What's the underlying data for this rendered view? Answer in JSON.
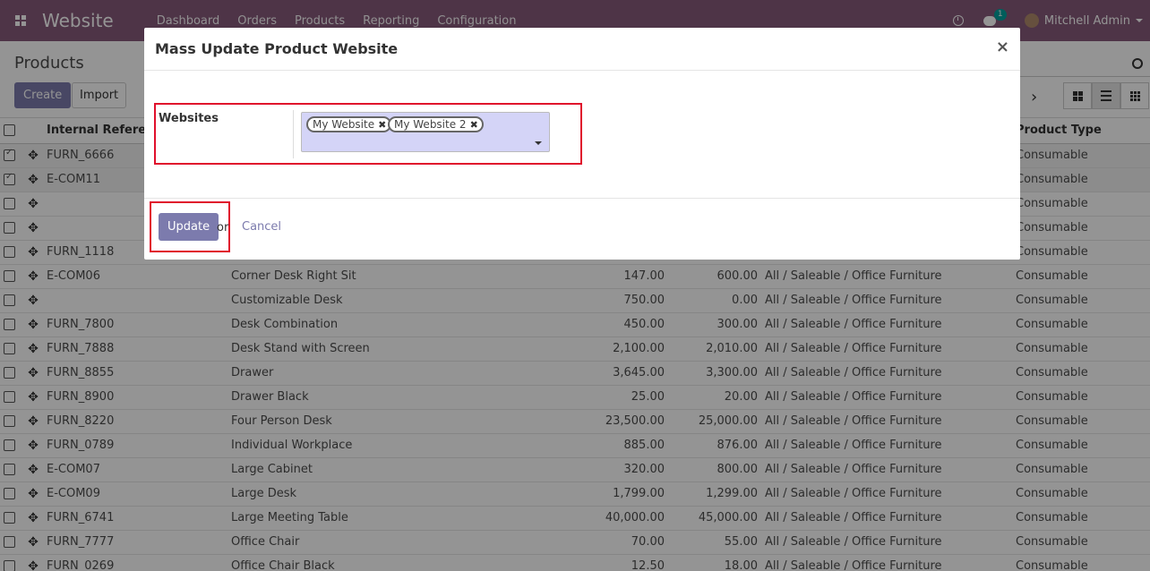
{
  "navbar": {
    "brand": "Website",
    "menu": [
      "Dashboard",
      "Orders",
      "Products",
      "Reporting",
      "Configuration"
    ],
    "chat_badge": "1",
    "user": "Mitchell Admin"
  },
  "control": {
    "breadcrumb": "Products",
    "create_label": "Create",
    "import_label": "Import"
  },
  "list": {
    "headers": {
      "internal_reference": "Internal Reference",
      "product_type": "Product Type"
    },
    "rows": [
      {
        "ref": "FURN_6666",
        "name": "",
        "price": "",
        "cost": "",
        "category": "",
        "type": "Consumable",
        "checked": true
      },
      {
        "ref": "E-COM11",
        "name": "",
        "price": "",
        "cost": "",
        "category": "",
        "type": "Consumable",
        "checked": true
      },
      {
        "ref": "",
        "name": "",
        "price": "",
        "cost": "",
        "category": "",
        "type": "Consumable",
        "checked": false
      },
      {
        "ref": "",
        "name": "",
        "price": "",
        "cost": "",
        "category": "",
        "type": "Consumable",
        "checked": false
      },
      {
        "ref": "FURN_1118",
        "name": "",
        "price": "",
        "cost": "",
        "category": "",
        "type": "Consumable",
        "checked": false
      },
      {
        "ref": "E-COM06",
        "name": "Corner Desk Right Sit",
        "price": "147.00",
        "cost": "600.00",
        "category": "All / Saleable / Office Furniture",
        "type": "Consumable",
        "checked": false
      },
      {
        "ref": "",
        "name": "Customizable Desk",
        "price": "750.00",
        "cost": "0.00",
        "category": "All / Saleable / Office Furniture",
        "type": "Consumable",
        "checked": false
      },
      {
        "ref": "FURN_7800",
        "name": "Desk Combination",
        "price": "450.00",
        "cost": "300.00",
        "category": "All / Saleable / Office Furniture",
        "type": "Consumable",
        "checked": false
      },
      {
        "ref": "FURN_7888",
        "name": "Desk Stand with Screen",
        "price": "2,100.00",
        "cost": "2,010.00",
        "category": "All / Saleable / Office Furniture",
        "type": "Consumable",
        "checked": false
      },
      {
        "ref": "FURN_8855",
        "name": "Drawer",
        "price": "3,645.00",
        "cost": "3,300.00",
        "category": "All / Saleable / Office Furniture",
        "type": "Consumable",
        "checked": false
      },
      {
        "ref": "FURN_8900",
        "name": "Drawer Black",
        "price": "25.00",
        "cost": "20.00",
        "category": "All / Saleable / Office Furniture",
        "type": "Consumable",
        "checked": false
      },
      {
        "ref": "FURN_8220",
        "name": "Four Person Desk",
        "price": "23,500.00",
        "cost": "25,000.00",
        "category": "All / Saleable / Office Furniture",
        "type": "Consumable",
        "checked": false
      },
      {
        "ref": "FURN_0789",
        "name": "Individual Workplace",
        "price": "885.00",
        "cost": "876.00",
        "category": "All / Saleable / Office Furniture",
        "type": "Consumable",
        "checked": false
      },
      {
        "ref": "E-COM07",
        "name": "Large Cabinet",
        "price": "320.00",
        "cost": "800.00",
        "category": "All / Saleable / Office Furniture",
        "type": "Consumable",
        "checked": false
      },
      {
        "ref": "E-COM09",
        "name": "Large Desk",
        "price": "1,799.00",
        "cost": "1,299.00",
        "category": "All / Saleable / Office Furniture",
        "type": "Consumable",
        "checked": false
      },
      {
        "ref": "FURN_6741",
        "name": "Large Meeting Table",
        "price": "40,000.00",
        "cost": "45,000.00",
        "category": "All / Saleable / Office Furniture",
        "type": "Consumable",
        "checked": false
      },
      {
        "ref": "FURN_7777",
        "name": "Office Chair",
        "price": "70.00",
        "cost": "55.00",
        "category": "All / Saleable / Office Furniture",
        "type": "Consumable",
        "checked": false
      },
      {
        "ref": "FURN_0269",
        "name": "Office Chair Black",
        "price": "12.50",
        "cost": "18.00",
        "category": "All / Saleable / Office Furniture",
        "type": "Consumable",
        "checked": false
      }
    ]
  },
  "modal": {
    "title": "Mass Update Product Website",
    "close": "×",
    "field_label": "Websites",
    "tags": [
      "My Website",
      "My Website 2"
    ],
    "update_label": "Update",
    "or_text": "or",
    "cancel_label": "Cancel"
  },
  "colors": {
    "navbar": "#875a7b",
    "primary": "#7c7bad",
    "highlight": "#e0102c",
    "tag_field_bg": "#d4d4f7"
  }
}
